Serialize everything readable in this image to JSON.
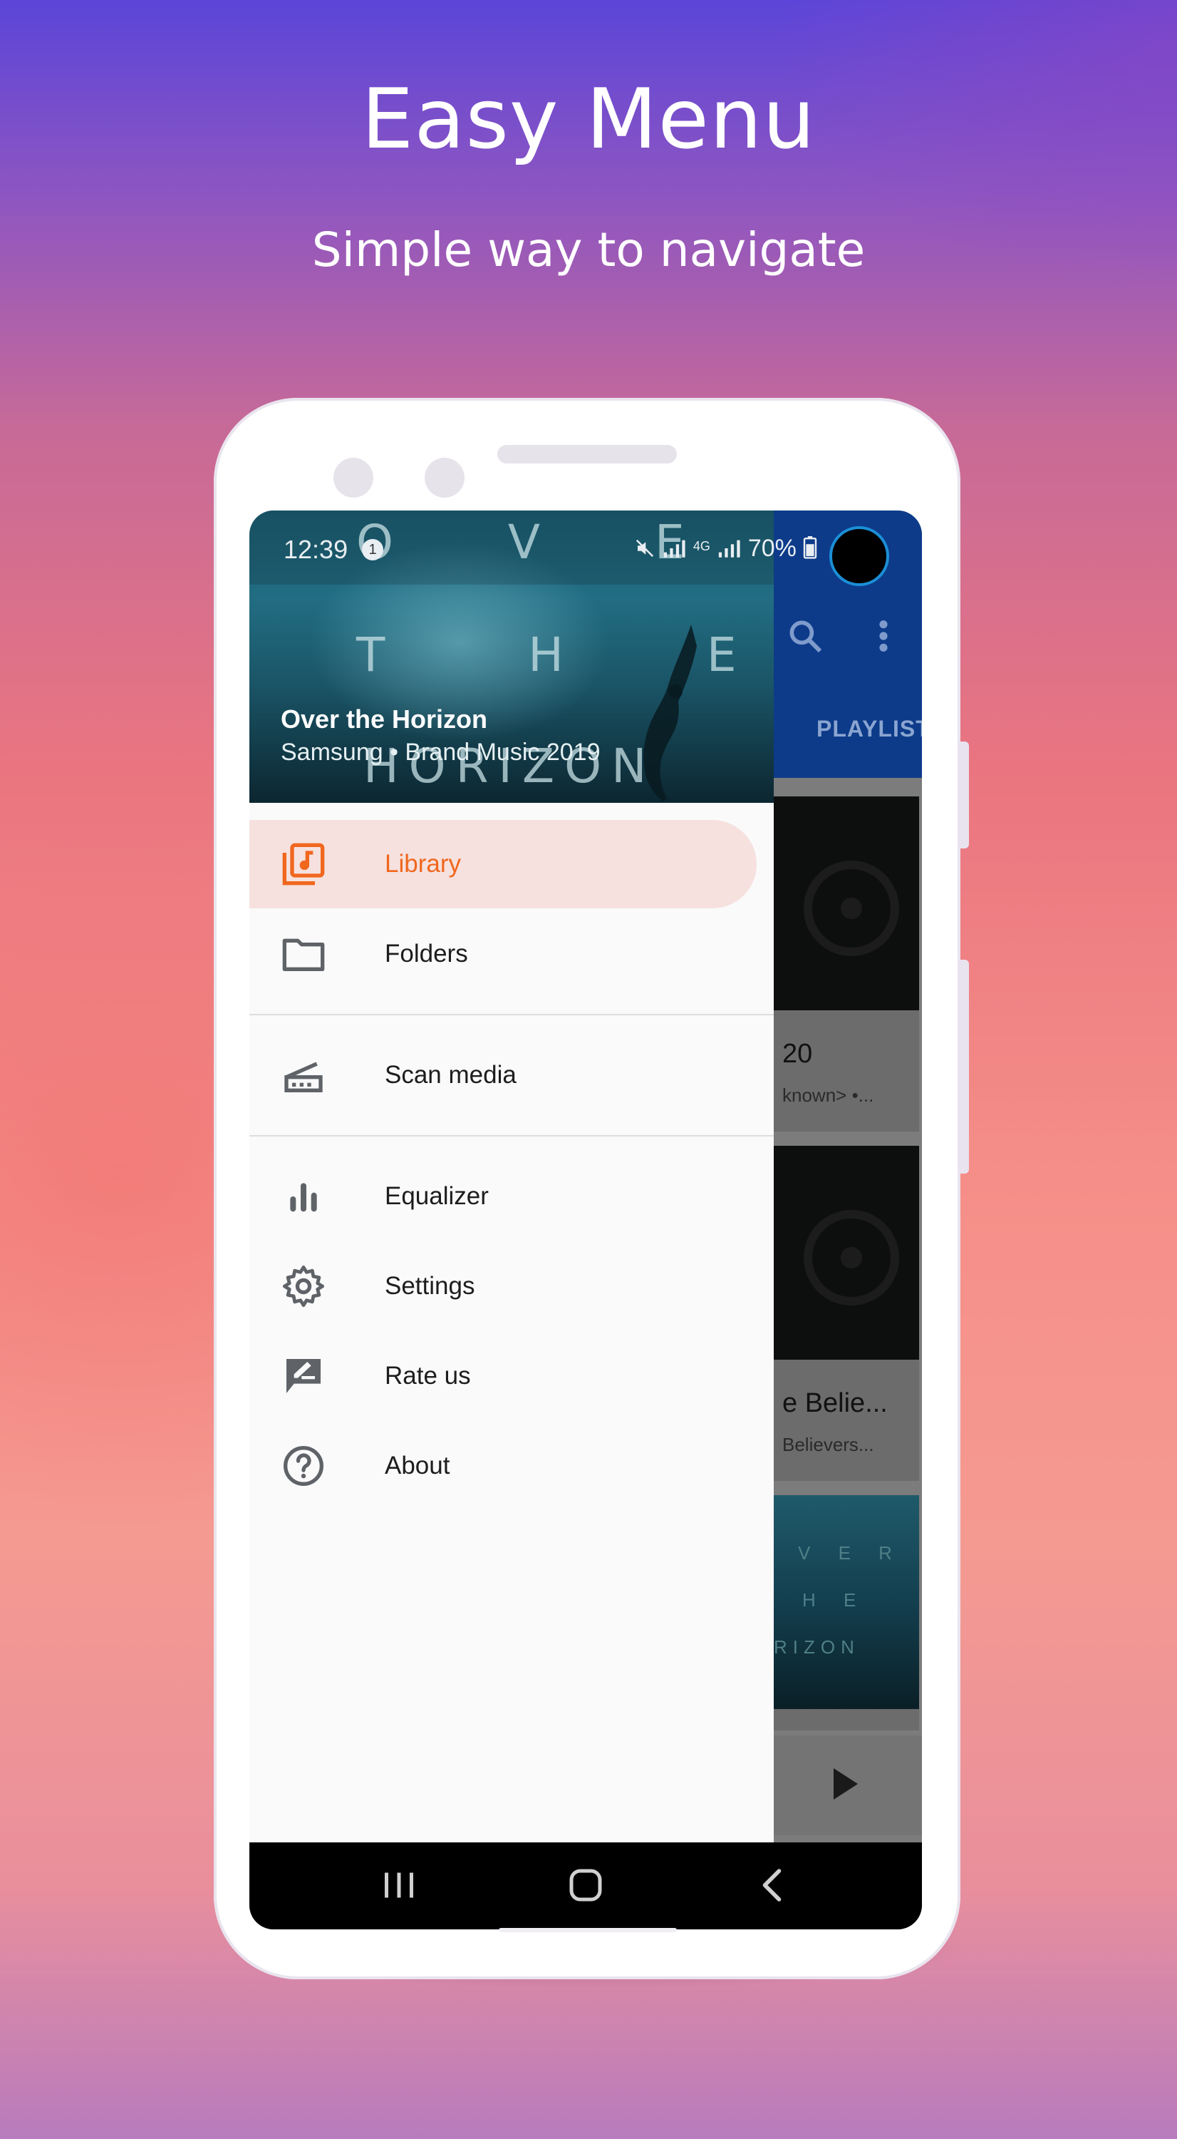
{
  "promo": {
    "title": "Easy Menu",
    "subtitle": "Simple way to navigate"
  },
  "status_bar": {
    "time": "12:39",
    "notification_count": "1",
    "network": "4G",
    "battery": "70%"
  },
  "background_app": {
    "tab_label": "PLAYLIST",
    "cards": [
      {
        "title": "20",
        "subtitle": "known> •..."
      },
      {
        "title": "e Belie...",
        "subtitle": "Believers..."
      },
      {
        "art_text": [
          "V E R",
          "H E",
          "RIZON"
        ]
      }
    ]
  },
  "drawer": {
    "header": {
      "song_title": "Over the Horizon",
      "song_meta": "Samsung • Brand Music 2019",
      "art_letters": [
        "O V E R",
        "T H E",
        "HORIZON"
      ]
    },
    "items": [
      {
        "label": "Library",
        "icon": "library-music-icon",
        "active": true
      },
      {
        "label": "Folders",
        "icon": "folder-icon",
        "active": false
      },
      {
        "label": "Scan media",
        "icon": "scan-media-icon",
        "active": false
      },
      {
        "label": "Equalizer",
        "icon": "equalizer-icon",
        "active": false
      },
      {
        "label": "Settings",
        "icon": "gear-icon",
        "active": false
      },
      {
        "label": "Rate us",
        "icon": "rate-review-icon",
        "active": false
      },
      {
        "label": "About",
        "icon": "help-circle-icon",
        "active": false
      }
    ]
  },
  "colors": {
    "accent": "#f0671e",
    "active_item_bg": "#f6e1de",
    "app_bar": "#0d3b8a"
  }
}
